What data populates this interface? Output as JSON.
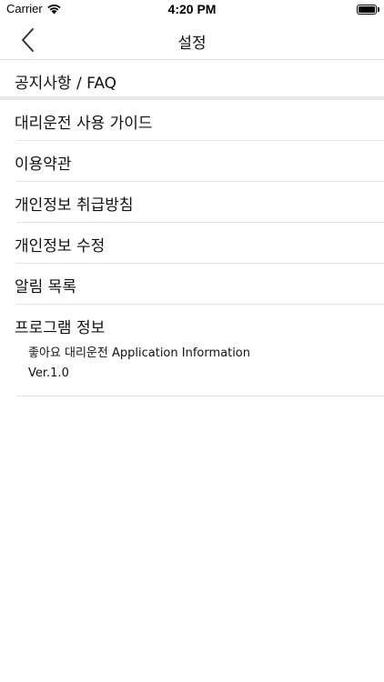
{
  "status_bar": {
    "carrier": "Carrier",
    "time": "4:20 PM",
    "wifi_icon": "wifi-icon",
    "battery_icon": "battery-icon"
  },
  "nav": {
    "title": "설정",
    "back_icon": "chevron-left-icon"
  },
  "menu": {
    "items": [
      {
        "label": "공지사항 / FAQ"
      },
      {
        "label": "대리운전 사용 가이드"
      },
      {
        "label": "이용약관"
      },
      {
        "label": "개인정보 취급방침"
      },
      {
        "label": "개인정보 수정"
      },
      {
        "label": "알림 목록"
      },
      {
        "label": "프로그램 정보"
      }
    ]
  },
  "program_info": {
    "app_name": "좋아요 대리운전 Application Information",
    "version": "Ver.1.0"
  }
}
